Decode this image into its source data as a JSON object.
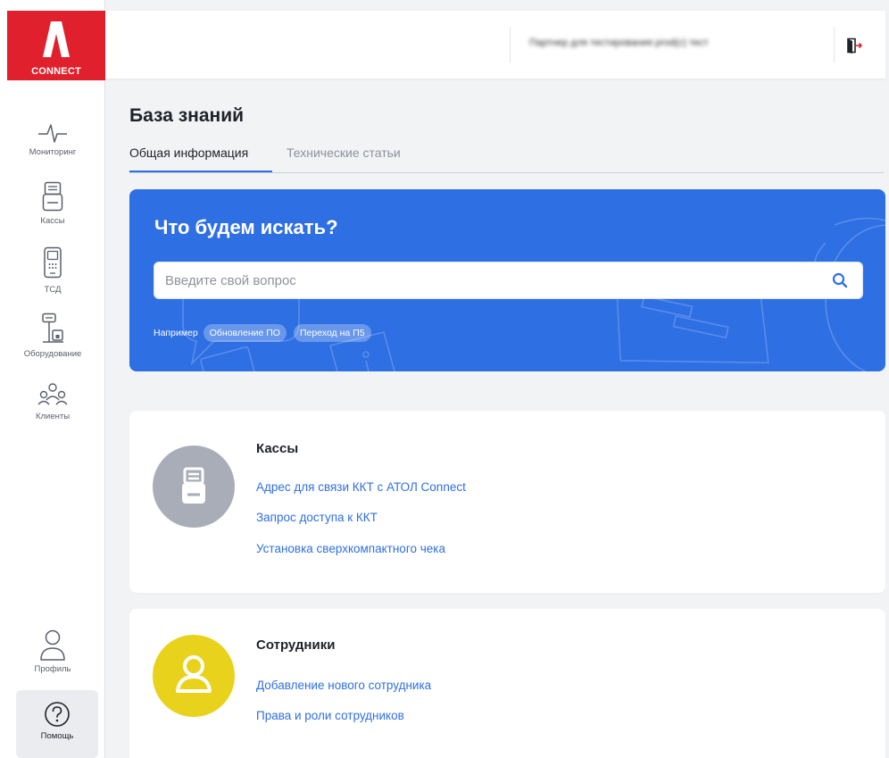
{
  "app": {
    "logo_text": "CONNECT",
    "partner_name": "Партнер для тестирования prod(с) тест"
  },
  "colors": {
    "brand_red": "#e0202c",
    "accent_blue": "#2f6fe4",
    "kassy_icon_bg": "#a9adb8",
    "employees_icon_bg": "#e9d21c"
  },
  "sidebar": {
    "items": [
      {
        "label": "Мониторинг",
        "icon": "pulse-icon"
      },
      {
        "label": "Кассы",
        "icon": "cash-register-icon"
      },
      {
        "label": "ТСД",
        "icon": "scanner-terminal-icon"
      },
      {
        "label": "Оборудование",
        "icon": "equipment-icon"
      },
      {
        "label": "Клиенты",
        "icon": "clients-icon"
      }
    ],
    "profile_label": "Профиль",
    "help_label": "Помощь"
  },
  "page": {
    "title": "База знаний",
    "tabs": [
      {
        "label": "Общая информация",
        "active": true
      },
      {
        "label": "Технические статьи",
        "active": false
      }
    ]
  },
  "search": {
    "heading": "Что будем искать?",
    "placeholder": "Введите свой вопрос",
    "value": "",
    "example_label": "Например",
    "examples": [
      "Обновление ПО",
      "Переход на П5"
    ]
  },
  "categories": [
    {
      "title": "Кассы",
      "icon": "cash-register-icon",
      "links": [
        "Адрес для связи ККТ с АТОЛ Connect",
        "Запрос доступа к ККТ",
        "Установка сверхкомпактного чека"
      ]
    },
    {
      "title": "Сотрудники",
      "icon": "user-icon",
      "links": [
        "Добавление нового сотрудника",
        "Права и роли сотрудников"
      ]
    }
  ]
}
